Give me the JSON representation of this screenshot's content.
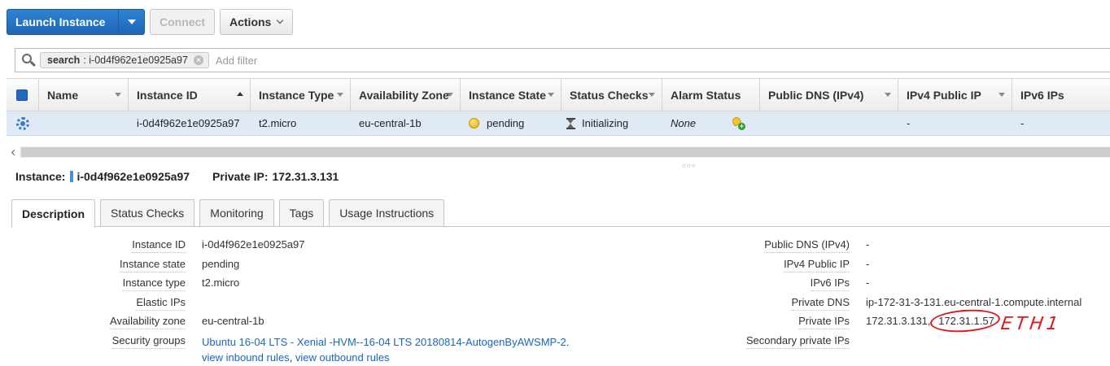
{
  "toolbar": {
    "launch_label": "Launch Instance",
    "connect_label": "Connect",
    "actions_label": "Actions"
  },
  "filter": {
    "token_key": "search",
    "token_value": ": i-0d4f962e1e0925a97",
    "placeholder": "Add filter"
  },
  "grid": {
    "columns": [
      "Name",
      "Instance ID",
      "Instance Type",
      "Availability Zone",
      "Instance State",
      "Status Checks",
      "Alarm Status",
      "Public DNS (IPv4)",
      "IPv4 Public IP",
      "IPv6 IPs"
    ],
    "row": {
      "name": "",
      "instance_id": "i-0d4f962e1e0925a97",
      "instance_type": "t2.micro",
      "availability_zone": "eu-central-1b",
      "instance_state": "pending",
      "status_checks": "Initializing",
      "alarm_status": "None",
      "public_dns": "",
      "ipv4_public_ip": "-",
      "ipv6_ips": "-"
    }
  },
  "detail": {
    "instance_label": "Instance:",
    "instance_value": "i-0d4f962e1e0925a97",
    "private_ip_label": "Private IP:",
    "private_ip_value": "172.31.3.131"
  },
  "tabs": [
    "Description",
    "Status Checks",
    "Monitoring",
    "Tags",
    "Usage Instructions"
  ],
  "description": {
    "left": [
      {
        "label": "Instance ID",
        "value": "i-0d4f962e1e0925a97"
      },
      {
        "label": "Instance state",
        "value": "pending"
      },
      {
        "label": "Instance type",
        "value": "t2.micro"
      },
      {
        "label": "Elastic IPs",
        "value": ""
      },
      {
        "label": "Availability zone",
        "value": "eu-central-1b"
      },
      {
        "label": "Security groups",
        "value": "Ubuntu 16-04 LTS - Xenial -HVM--16-04 LTS 20180814-AutogenByAWSMP-2",
        "link_view_inbound": "view inbound rules",
        "link_view_outbound": "view outbound rules"
      }
    ],
    "right": [
      {
        "label": "Public DNS (IPv4)",
        "value": "-"
      },
      {
        "label": "IPv4 Public IP",
        "value": "-"
      },
      {
        "label": "IPv6 IPs",
        "value": "-"
      },
      {
        "label": "Private DNS",
        "value": "ip-172-31-3-131.eu-central-1.compute.internal"
      },
      {
        "label": "Private IPs",
        "value_primary": "172.31.3.131,",
        "value_secondary": "172.31.1.57"
      },
      {
        "label": "Secondary private IPs",
        "value": ""
      }
    ],
    "annotation": "ETH1"
  },
  "colors": {
    "primary_button": "#1e66b8",
    "selected_row": "#dfeaf6",
    "link": "#1a66b8",
    "annotation": "#e0161e"
  }
}
